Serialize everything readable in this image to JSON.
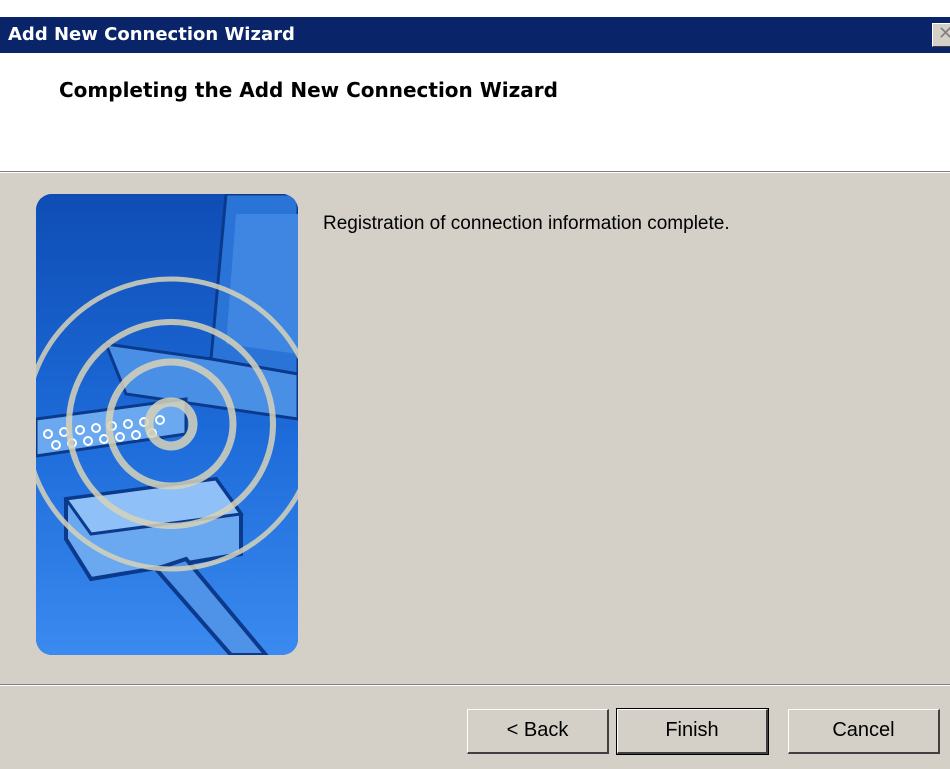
{
  "window": {
    "title": "Add New Connection Wizard",
    "close_glyph": "✕"
  },
  "header": {
    "title": "Completing the Add New Connection Wizard"
  },
  "sidebar_image": {
    "icon": "network-cable-signal-illustration"
  },
  "content": {
    "message": "Registration of connection information complete."
  },
  "buttons": {
    "back": "< Back",
    "finish": "Finish",
    "cancel": "Cancel"
  },
  "colors": {
    "titlebar": "#0a246a",
    "dialog_face": "#d4d0c8",
    "header_bg": "#ffffff",
    "image_blue": "#1b5fc8"
  }
}
